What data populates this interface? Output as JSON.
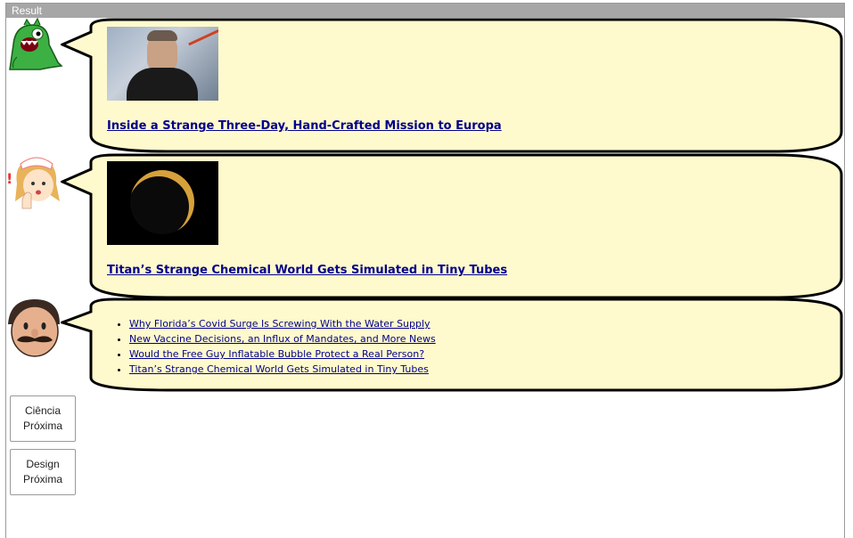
{
  "window": {
    "title": "Result"
  },
  "bubbles": [
    {
      "headline": "Inside a Strange Three-Day, Hand-Crafted Mission to Europa"
    },
    {
      "headline": "Titan’s Strange Chemical World Gets Simulated in Tiny Tubes"
    },
    {
      "links": [
        "Why Florida’s Covid Surge Is Screwing With the Water Supply",
        "New Vaccine Decisions, an Influx of Mandates, and More News",
        "Would the Free Guy Inflatable Bubble Protect a Real Person?",
        "Titan’s Strange Chemical World Gets Simulated in Tiny Tubes"
      ]
    }
  ],
  "buttons": {
    "ciencia": "Ciência\nPróxima",
    "design": "Design\nPróxima"
  },
  "colors": {
    "bubble_fill": "#fffacd",
    "link": "#00008b",
    "titlebar": "#a6a6a6"
  }
}
